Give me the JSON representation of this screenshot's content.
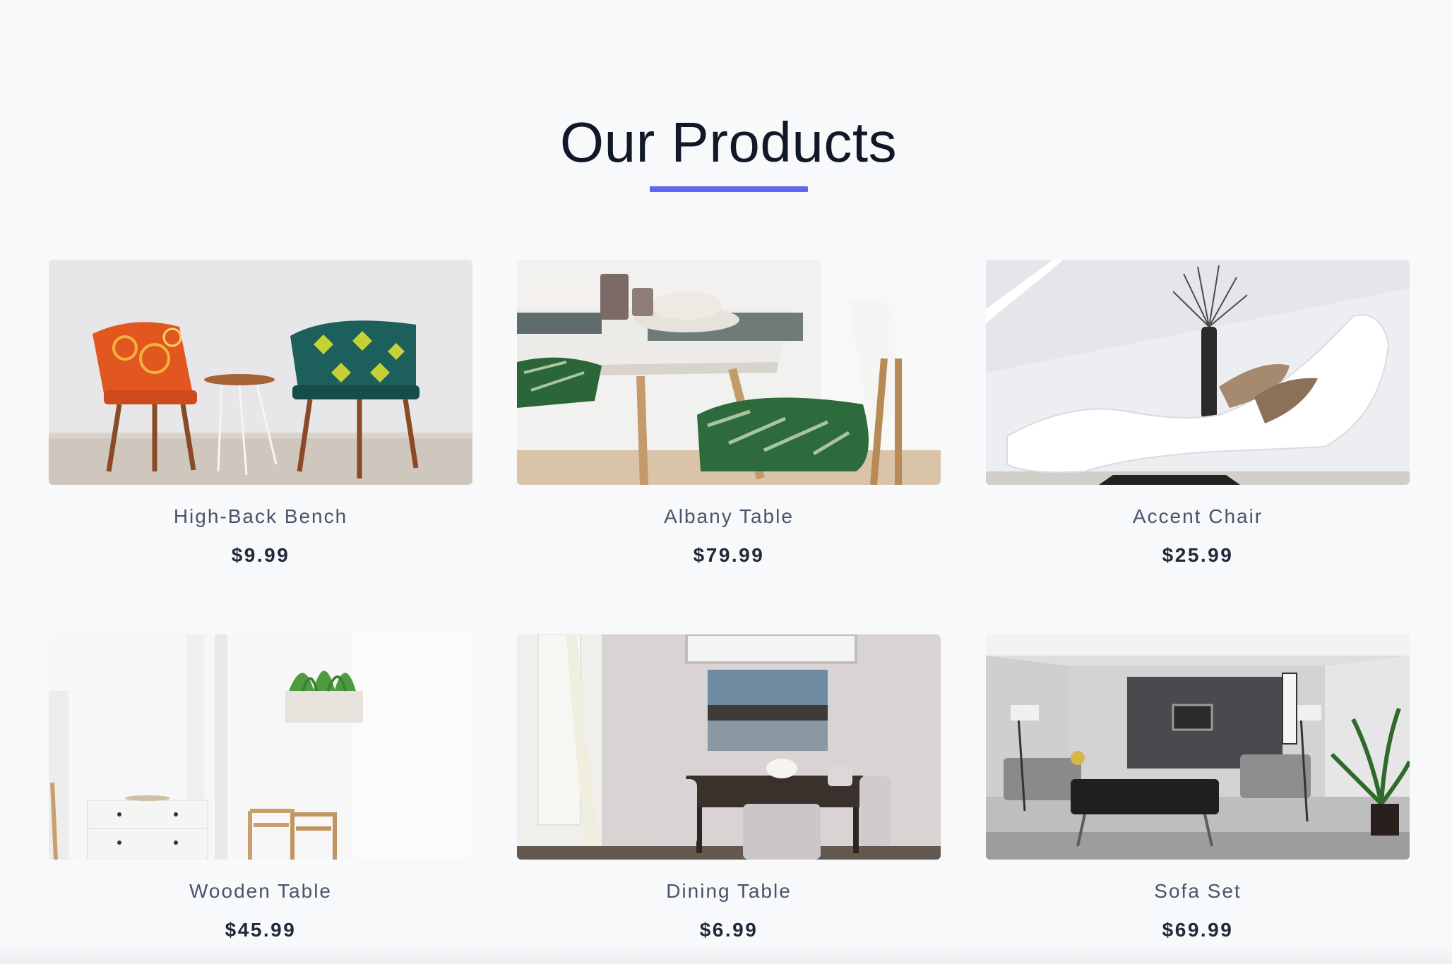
{
  "section": {
    "title": "Our Products",
    "accent_color": "#6366f1"
  },
  "products": [
    {
      "name": "High-Back Bench",
      "price": "$9.99",
      "image": "patterned-chairs-image"
    },
    {
      "name": "Albany Table",
      "price": "$79.99",
      "image": "dining-table-image"
    },
    {
      "name": "Accent Chair",
      "price": "$25.99",
      "image": "white-lounge-chair-image"
    },
    {
      "name": "Wooden Table",
      "price": "$45.99",
      "image": "white-room-image"
    },
    {
      "name": "Dining Table",
      "price": "$6.99",
      "image": "dining-room-image"
    },
    {
      "name": "Sofa Set",
      "price": "$69.99",
      "image": "living-room-image"
    }
  ]
}
